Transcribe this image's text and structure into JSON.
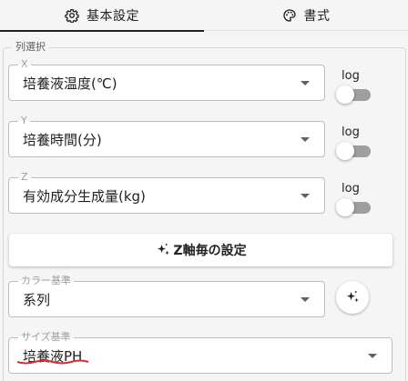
{
  "tabs": [
    {
      "label": "基本設定",
      "icon": "gear-icon",
      "active": true
    },
    {
      "label": "書式",
      "icon": "palette-icon",
      "active": false
    }
  ],
  "column_select": {
    "legend": "列選択",
    "x": {
      "label": "X",
      "value": "培養液温度(℃)",
      "log_label": "log"
    },
    "y": {
      "label": "Y",
      "value": "培養時間(分)",
      "log_label": "log"
    },
    "z": {
      "label": "Z",
      "value": "有効成分生成量(kg)",
      "log_label": "log"
    },
    "z_settings_button": "Z軸毎の設定",
    "color_basis": {
      "label": "カラー基準",
      "value": "系列"
    },
    "size_basis": {
      "label": "サイズ基準",
      "value": "培養液PH"
    }
  },
  "colors": {
    "spellcheck_underline": "#d32f2f",
    "toggle_track": "#9e9e9e"
  }
}
